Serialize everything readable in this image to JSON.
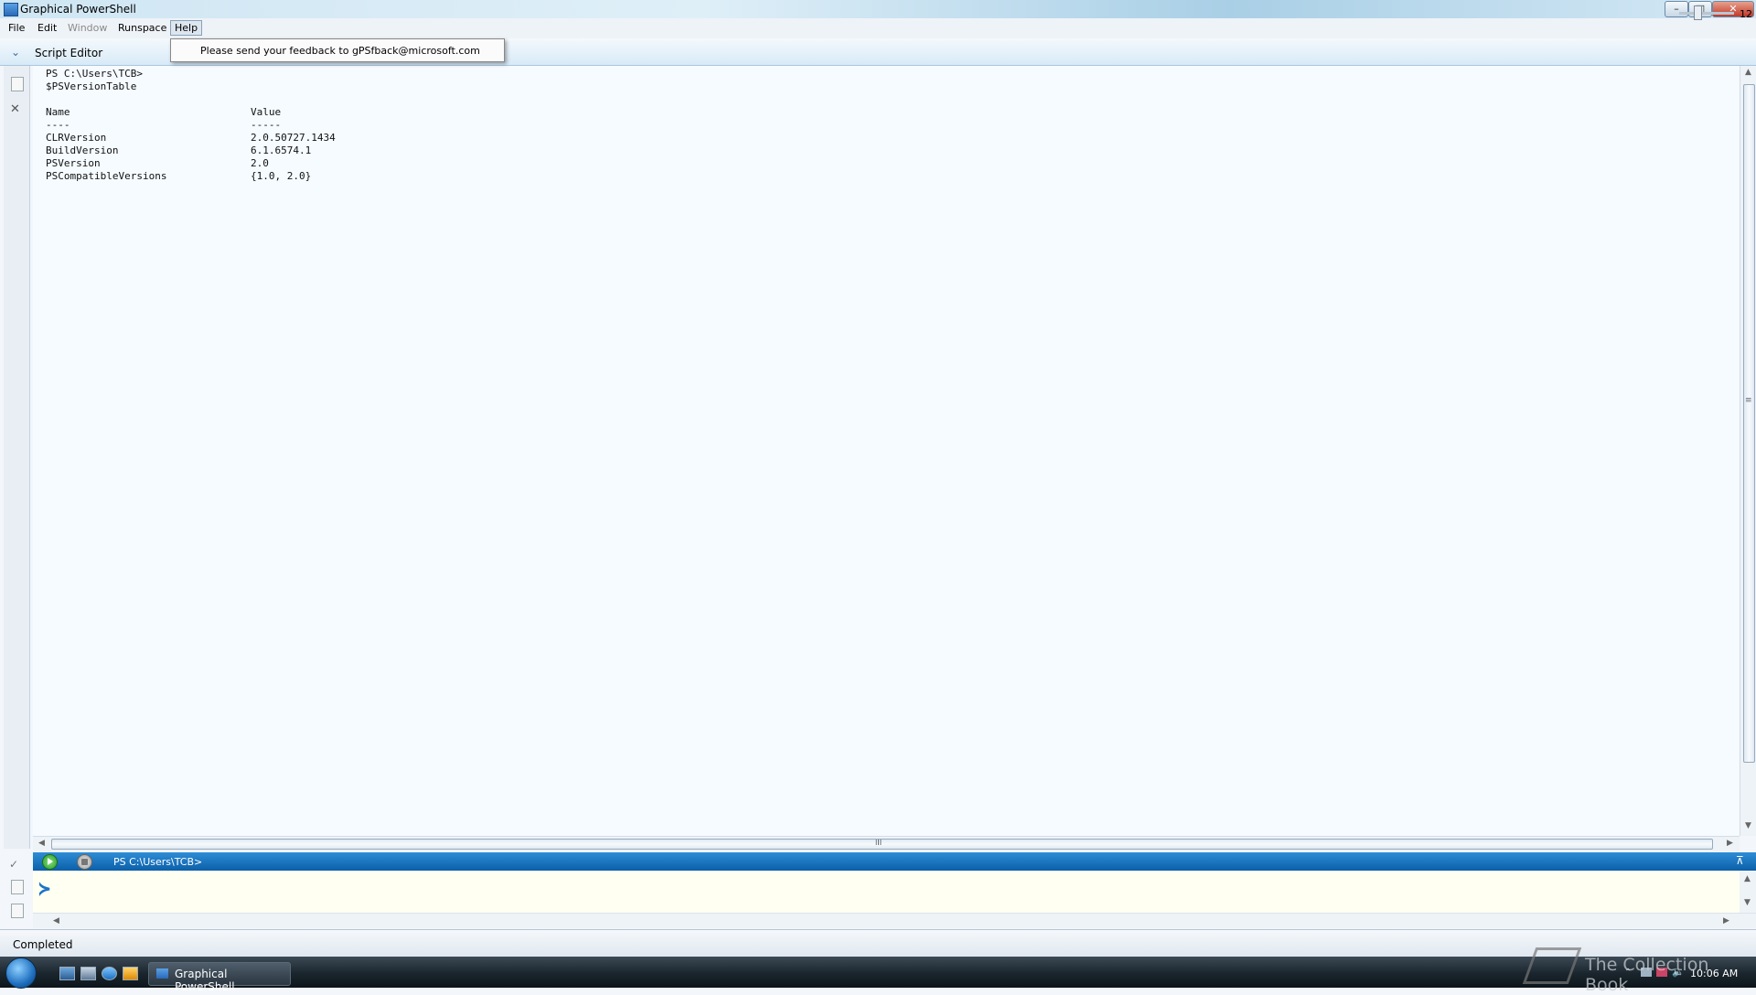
{
  "window": {
    "title": "Graphical PowerShell",
    "controls": {
      "minimize": "–",
      "maximize": "□",
      "close": "✕"
    }
  },
  "menu": {
    "items": [
      {
        "label": "File",
        "enabled": true
      },
      {
        "label": "Edit",
        "enabled": true
      },
      {
        "label": "Window",
        "enabled": false
      },
      {
        "label": "Runspace",
        "enabled": true
      },
      {
        "label": "Help",
        "enabled": true,
        "open": true
      }
    ],
    "help_dropdown": {
      "item": "Please send your feedback to gPSfback@microsoft.com"
    }
  },
  "script_editor": {
    "label": "Script Editor",
    "lines": {
      "prompt": "PS C:\\Users\\TCB>",
      "command": "$PSVersionTable",
      "header_name": "Name",
      "header_value": "Value",
      "sep_name": "----",
      "sep_value": "-----"
    },
    "rows": [
      {
        "name": "CLRVersion",
        "value": "2.0.50727.1434"
      },
      {
        "name": "BuildVersion",
        "value": "6.1.6574.1"
      },
      {
        "name": "PSVersion",
        "value": "2.0"
      },
      {
        "name": "PSCompatibleVersions",
        "value": "{1.0, 2.0}"
      }
    ],
    "hscroll_grip": "III",
    "vscroll_grip": "≡"
  },
  "console": {
    "path": "PS C:\\Users\\TCB>",
    "prompt_glyph": "≻"
  },
  "status": {
    "text": "Completed",
    "zoom": "12"
  },
  "taskbar": {
    "task_label": "Graphical PowerShell",
    "time": "10:06 AM",
    "watermark": "The Collection Book"
  },
  "icons": [
    "app-icon",
    "chevron-down-icon",
    "run-icon",
    "stop-icon",
    "pin-icon",
    "prompt-icon",
    "start-orb-icon"
  ],
  "colors": {
    "accent": "#0b5fa8",
    "editor_bg": "#f5fbff",
    "input_bg": "#fffff2"
  }
}
